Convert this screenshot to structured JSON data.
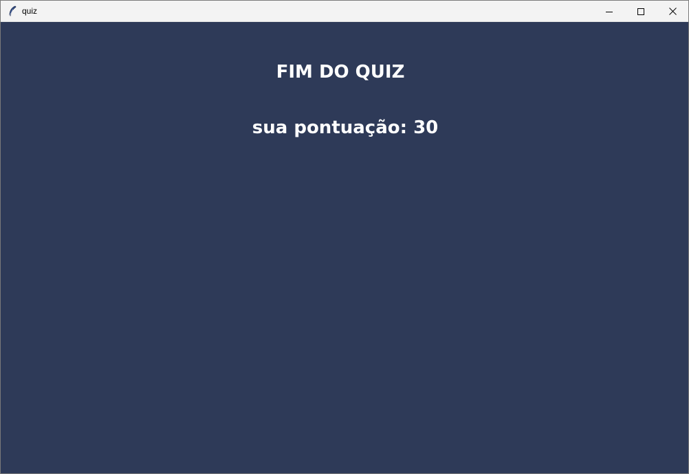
{
  "window": {
    "title": "quiz",
    "app_icon": "feather-icon",
    "controls": {
      "minimize_icon": "minimize-icon",
      "maximize_icon": "maximize-icon",
      "close_icon": "close-icon"
    }
  },
  "quiz": {
    "heading": "FIM DO QUIZ",
    "score_text": "sua pontuação: 30"
  },
  "colors": {
    "background": "#2e3a58",
    "text": "#ffffff",
    "titlebar": "#f3f3f3"
  }
}
